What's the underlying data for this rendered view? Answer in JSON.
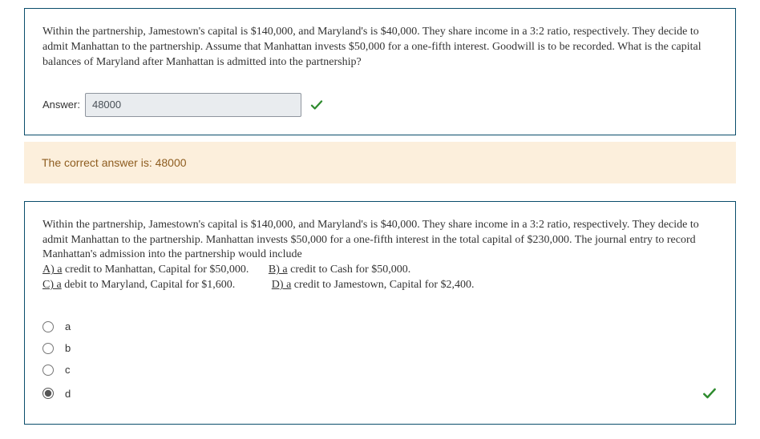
{
  "q1": {
    "text": "Within the partnership, Jamestown's capital is $140,000, and Maryland's is $40,000. They share income in a 3:2 ratio, respectively. They decide to admit Manhattan to the partnership. Assume that Manhattan invests $50,000 for a one-fifth interest. Goodwill is to be recorded. What is the capital balances of Maryland after Manhattan is admitted into the partnership?",
    "answer_label": "Answer:",
    "answer_value": "48000"
  },
  "feedback": {
    "text": "The correct answer is: 48000"
  },
  "q2": {
    "intro": "Within the partnership, Jamestown's capital is $140,000, and Maryland's is $40,000. They share income in a 3:2 ratio, respectively. They decide to admit Manhattan to the partnership. Manhattan invests $50,000 for a one-fifth interest in the total capital of $230,000. The journal entry to record Manhattan's admission into the partnership would include",
    "choice_a_letter": "A) a",
    "choice_a_text": " credit to Manhattan, Capital for $50,000.",
    "choice_b_letter": "B) a",
    "choice_b_text": " credit to Cash for $50,000.",
    "choice_c_letter": "C) a",
    "choice_c_text": " debit to Maryland, Capital for $1,600.",
    "choice_d_letter": "D) a",
    "choice_d_text": " credit to Jamestown, Capital for $2,400.",
    "options": {
      "a": "a",
      "b": "b",
      "c": "c",
      "d": "d"
    },
    "selected": "d"
  }
}
